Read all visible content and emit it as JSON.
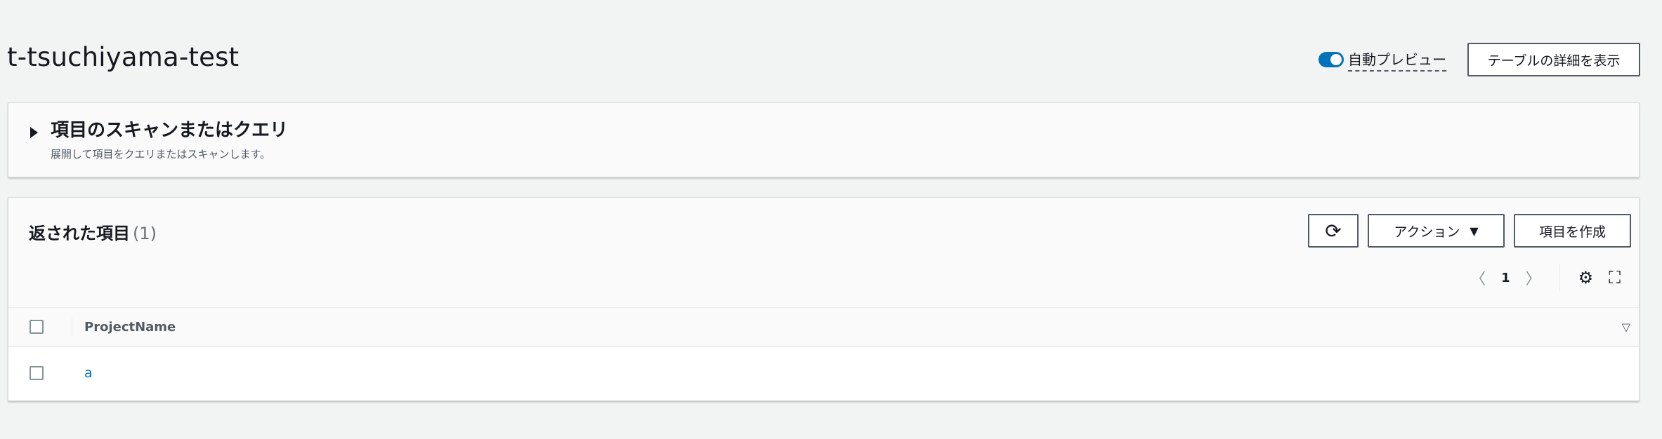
{
  "header": {
    "title": "t-tsuchiyama-test",
    "auto_preview_label": "自動プレビュー",
    "auto_preview_on": true,
    "details_button": "テーブルの詳細を表示"
  },
  "scan_panel": {
    "title": "項目のスキャンまたはクエリ",
    "description": "展開して項目をクエリまたはスキャンします。"
  },
  "items_panel": {
    "title": "返された項目",
    "count": "(1)",
    "refresh_icon": "refresh-icon",
    "actions_button": "アクション",
    "actions_caret": "▼",
    "create_button": "項目を作成",
    "pagination": {
      "prev": "〈",
      "page": "1",
      "next": "〉"
    },
    "columns": [
      "ProjectName"
    ],
    "rows": [
      {
        "ProjectName": "a"
      }
    ]
  },
  "colors": {
    "accent": "#0073bb",
    "background": "#f2f3f3"
  }
}
